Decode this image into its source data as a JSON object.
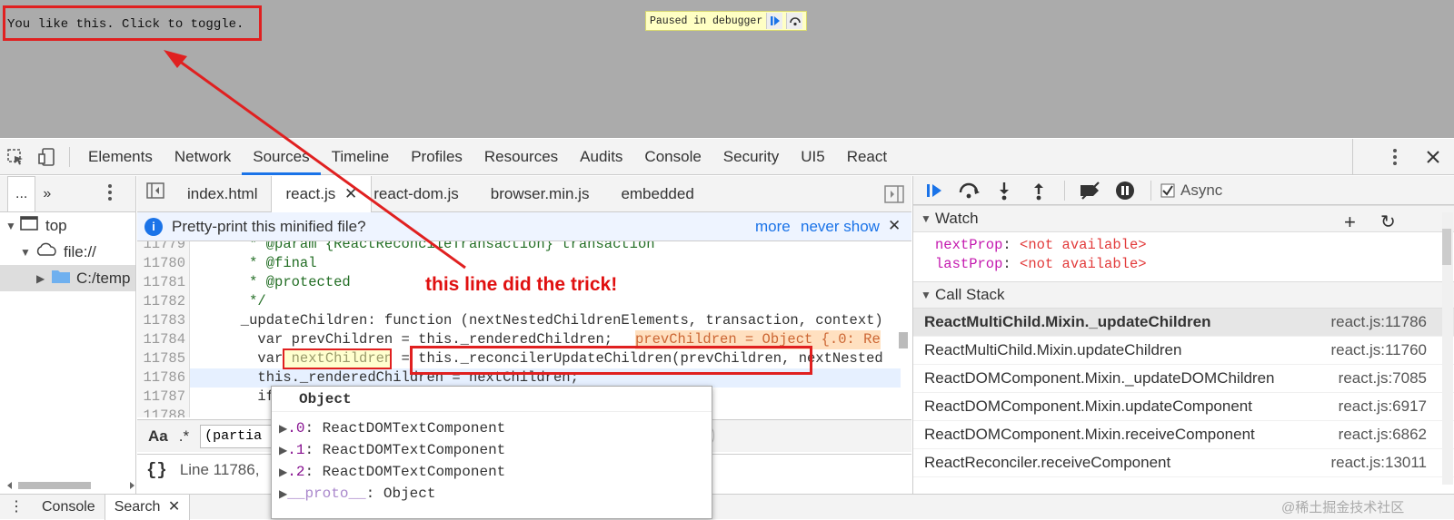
{
  "page": {
    "content_text": "You like this. Click to toggle.",
    "paused_text": "Paused in debugger"
  },
  "devtools": {
    "tabs": [
      "Elements",
      "Network",
      "Sources",
      "Timeline",
      "Profiles",
      "Resources",
      "Audits",
      "Console",
      "Security",
      "UI5",
      "React"
    ],
    "active_tab": "Sources"
  },
  "navigator": {
    "tab_more": "...",
    "tree": [
      {
        "label": "top"
      },
      {
        "label": "file://"
      },
      {
        "label": "C:/temp"
      }
    ]
  },
  "editor": {
    "tabs": [
      "index.html",
      "react.js",
      "react-dom.js",
      "browser.min.js",
      "embedded"
    ],
    "active_tab": "react.js",
    "prettyprint_msg": "Pretty-print this minified file?",
    "prettyprint_more": "more",
    "prettyprint_never": "never show",
    "lines": [
      {
        "num": "11779",
        "code": "       * @param {ReactReconcileTransaction} transaction"
      },
      {
        "num": "11780",
        "code": "       * @final"
      },
      {
        "num": "11781",
        "code": "       * @protected"
      },
      {
        "num": "11782",
        "code": "       */"
      },
      {
        "num": "11783",
        "code": "      _updateChildren: function (nextNestedChildrenElements, transaction, context)"
      },
      {
        "num": "11784",
        "code": "        var prevChildren = this._renderedChildren;"
      },
      {
        "num": "11785",
        "code": "        var nextChildren = this._reconcilerUpdateChildren(prevChildren, nextNested"
      },
      {
        "num": "11786",
        "code": "        this._renderedChildren = nextChildren;"
      },
      {
        "num": "11787",
        "code": "        if"
      },
      {
        "num": "11788",
        "code": ""
      }
    ],
    "inline_value": "prevChildren = Object {.0: Re",
    "search_case": "Aa",
    "search_regex": ".*",
    "search_value": "(partia",
    "search_cancel": "el",
    "status_braces": "{}",
    "status_text": "Line 11786,"
  },
  "annotation": "this line did the trick!",
  "debugger": {
    "async_label": "Async",
    "watch_title": "Watch",
    "watch": [
      {
        "name": "nextProp",
        "value": "<not available>"
      },
      {
        "name": "lastProp",
        "value": "<not available>"
      }
    ],
    "callstack_title": "Call Stack",
    "callstack": [
      {
        "fn": "ReactMultiChild.Mixin._updateChildren",
        "loc": "react.js:11786"
      },
      {
        "fn": "ReactMultiChild.Mixin.updateChildren",
        "loc": "react.js:11760"
      },
      {
        "fn": "ReactDOMComponent.Mixin._updateDOMChildren",
        "loc": "react.js:7085"
      },
      {
        "fn": "ReactDOMComponent.Mixin.updateComponent",
        "loc": "react.js:6917"
      },
      {
        "fn": "ReactDOMComponent.Mixin.receiveComponent",
        "loc": "react.js:6862"
      },
      {
        "fn": "ReactReconciler.receiveComponent",
        "loc": "react.js:13011"
      }
    ]
  },
  "popover": {
    "title": "Object",
    "rows": [
      {
        "key": ".0",
        "value": "ReactDOMTextComponent"
      },
      {
        "key": ".1",
        "value": "ReactDOMTextComponent"
      },
      {
        "key": ".2",
        "value": "ReactDOMTextComponent"
      },
      {
        "key": "__proto__",
        "value": "Object"
      }
    ]
  },
  "drawer": {
    "tabs": [
      "Console",
      "Search"
    ]
  },
  "watermark": "@稀土掘金技术社区",
  "colors": {
    "accent": "#1a73e8",
    "annotation": "#e02020"
  }
}
